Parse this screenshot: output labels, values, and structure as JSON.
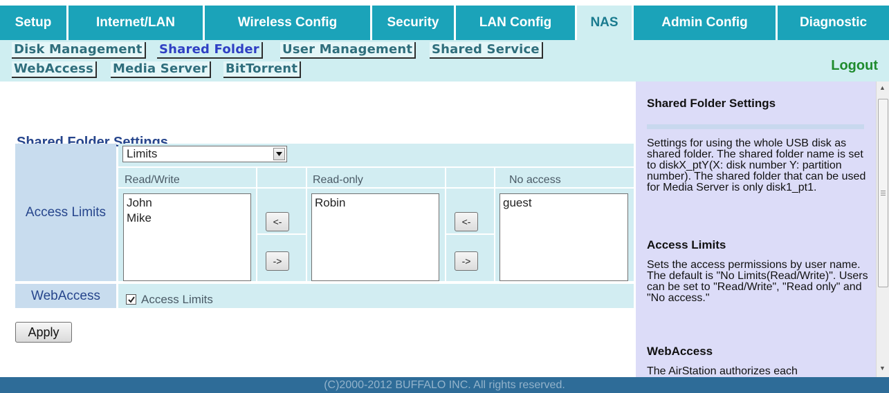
{
  "nav": {
    "tabs": [
      "Setup",
      "Internet/LAN",
      "Wireless Config",
      "Security",
      "LAN Config",
      "NAS",
      "Admin Config",
      "Diagnostic"
    ],
    "active_tab": "NAS"
  },
  "subnav": {
    "items": [
      "Disk Management",
      "Shared Folder",
      "User Management",
      "Shared Service",
      "WebAccess",
      "Media Server",
      "BitTorrent"
    ],
    "active_item": "Shared Folder",
    "logout": "Logout"
  },
  "form": {
    "title": "Shared Folder Settings",
    "access_limits_label": "Access Limits",
    "access_mode_selected": "Limits",
    "columns": {
      "read_write": "Read/Write",
      "read_only": "Read-only",
      "no_access": "No access"
    },
    "lists": {
      "read_write": [
        "John",
        "Mike"
      ],
      "read_only": [
        "Robin"
      ],
      "no_access": [
        "guest"
      ]
    },
    "move_left": "<-",
    "move_right": "->",
    "webaccess_label": "WebAccess",
    "webaccess_checkbox_label": "Access Limits",
    "webaccess_checked": true,
    "apply_label": "Apply"
  },
  "help": {
    "heading1": "Shared Folder Settings",
    "text1": "Settings for using the whole USB disk as shared folder. The shared folder name is set to diskX_ptY(X: disk number Y: partition number). The shared folder that can be used for Media Server is only disk1_pt1.",
    "heading2": "Access Limits",
    "text2": "Sets the access permissions by user name. The default is \"No Limits(Read/Write)\". Users can be set to \"Read/Write\", \"Read only\" and \"No access.\"",
    "heading3": "WebAccess",
    "text3": "The AirStation authorizes each"
  },
  "footer": {
    "text": "(C)2000-2012 BUFFALO INC. All rights reserved."
  },
  "icons": {
    "dropdown": "chevron-down-icon",
    "check": "checkmark-icon",
    "scroll_up": "arrow-up-icon",
    "scroll_down": "arrow-down-icon"
  }
}
